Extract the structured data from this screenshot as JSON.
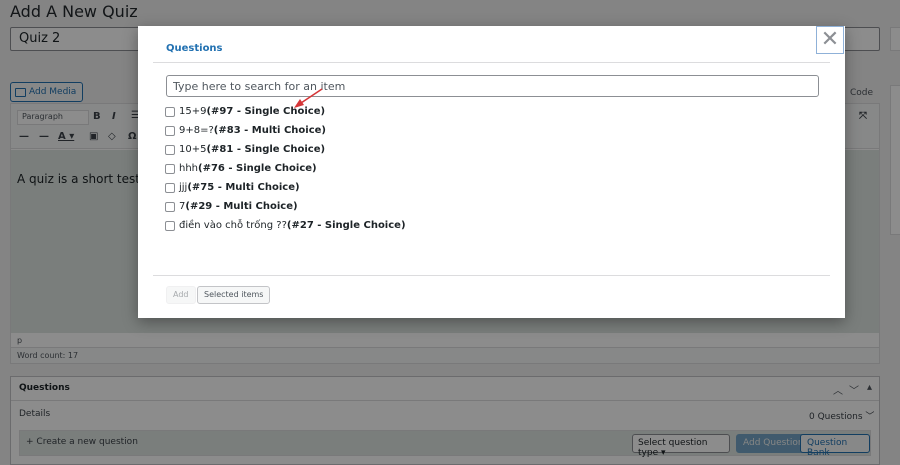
{
  "page": {
    "title": "Add A New Quiz",
    "quiz_title_value": "Quiz 2"
  },
  "editor": {
    "add_media_label": "Add Media",
    "code_tab": "Code",
    "format_select": "Paragraph",
    "content_text": "A quiz is a short test o",
    "status_path": "p",
    "word_count": "Word count: 17"
  },
  "questions_panel": {
    "title": "Questions",
    "details_label": "Details",
    "question_count": "0 Questions",
    "create_label": "Create a new question",
    "select_type_label": "Select question type",
    "add_question_label": "Add Question",
    "question_bank_label": "Question Bank"
  },
  "modal": {
    "tab_label": "Questions",
    "close_glyph": "✕",
    "search_placeholder": "Type here to search for an item",
    "items": [
      {
        "text": "15+9",
        "meta": "(#97 - Single Choice)"
      },
      {
        "text": "9+8=?",
        "meta": "(#83 - Multi Choice)"
      },
      {
        "text": "10+5",
        "meta": "(#81 - Single Choice)"
      },
      {
        "text": "hhh",
        "meta": "(#76 - Single Choice)"
      },
      {
        "text": "jjj",
        "meta": "(#75 - Multi Choice)"
      },
      {
        "text": "7",
        "meta": "(#29 - Multi Choice)"
      },
      {
        "text": "điền vào chỗ trống ??",
        "meta": "(#27 - Single Choice)"
      }
    ],
    "add_label": "Add",
    "selected_items_label": "Selected items"
  },
  "colors": {
    "accent": "#2271b1",
    "annotation_arrow": "#d63638",
    "content_bg": "#dfe6e2"
  }
}
